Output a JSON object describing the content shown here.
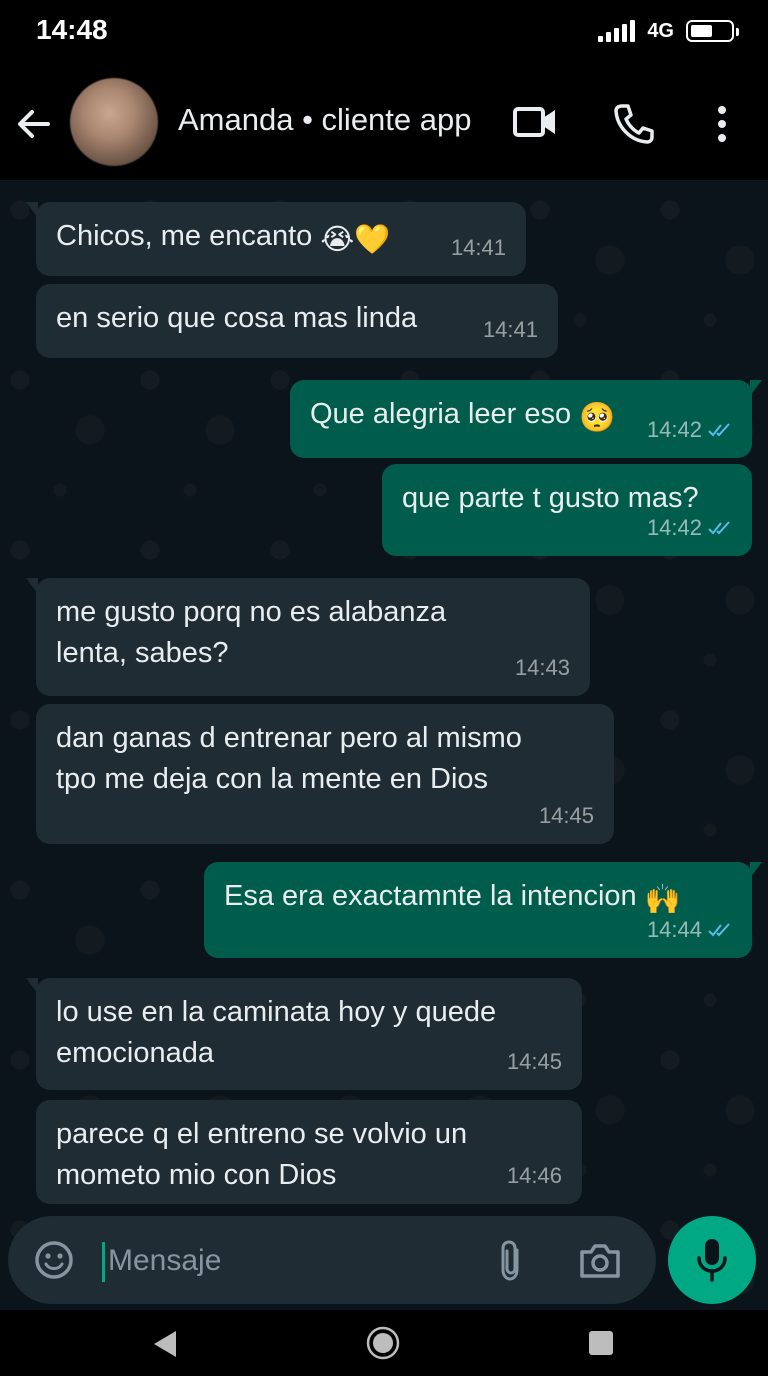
{
  "status_bar": {
    "time": "14:48",
    "network": "4G",
    "battery_level": 0.55
  },
  "header": {
    "contact_name": "Amanda • cliente app",
    "icons": [
      "back-arrow-icon",
      "video-call-icon",
      "phone-icon",
      "more-vert-icon"
    ]
  },
  "messages": [
    {
      "direction": "in",
      "text": "Chicos, me encanto",
      "emoji": "😭💛",
      "time": "14:41"
    },
    {
      "direction": "in",
      "text": "en serio que cosa mas linda",
      "time": "14:41"
    },
    {
      "direction": "out",
      "text": "Que alegria leer eso",
      "emoji": "🥺",
      "time": "14:42",
      "status": "read"
    },
    {
      "direction": "out",
      "text": "que parte t gusto mas?",
      "time": "14:42",
      "status": "read"
    },
    {
      "direction": "in",
      "text": "me gusto porq no es alabanza\nlenta, sabes?",
      "time": "14:43"
    },
    {
      "direction": "in",
      "text": "dan ganas d entrenar pero al mismo\ntpo me deja con la mente en Dios",
      "time": "14:45"
    },
    {
      "direction": "out",
      "text": "Esa era exactamnte la intencion",
      "emoji": "🙌",
      "time": "14:44",
      "status": "read"
    },
    {
      "direction": "in",
      "text": "lo use en la caminata hoy y quede\nemocionada",
      "time": "14:45"
    },
    {
      "direction": "in",
      "text": "parece q el entreno se volvio un\nmometo mio con Dios",
      "time": "14:46"
    }
  ],
  "input": {
    "placeholder": "Mensaje"
  },
  "colors": {
    "background": "#0b141a",
    "incoming_bubble": "#1f2c33",
    "outgoing_bubble": "#005c4b",
    "accent": "#00a884",
    "read_ticks": "#53bdeb"
  }
}
